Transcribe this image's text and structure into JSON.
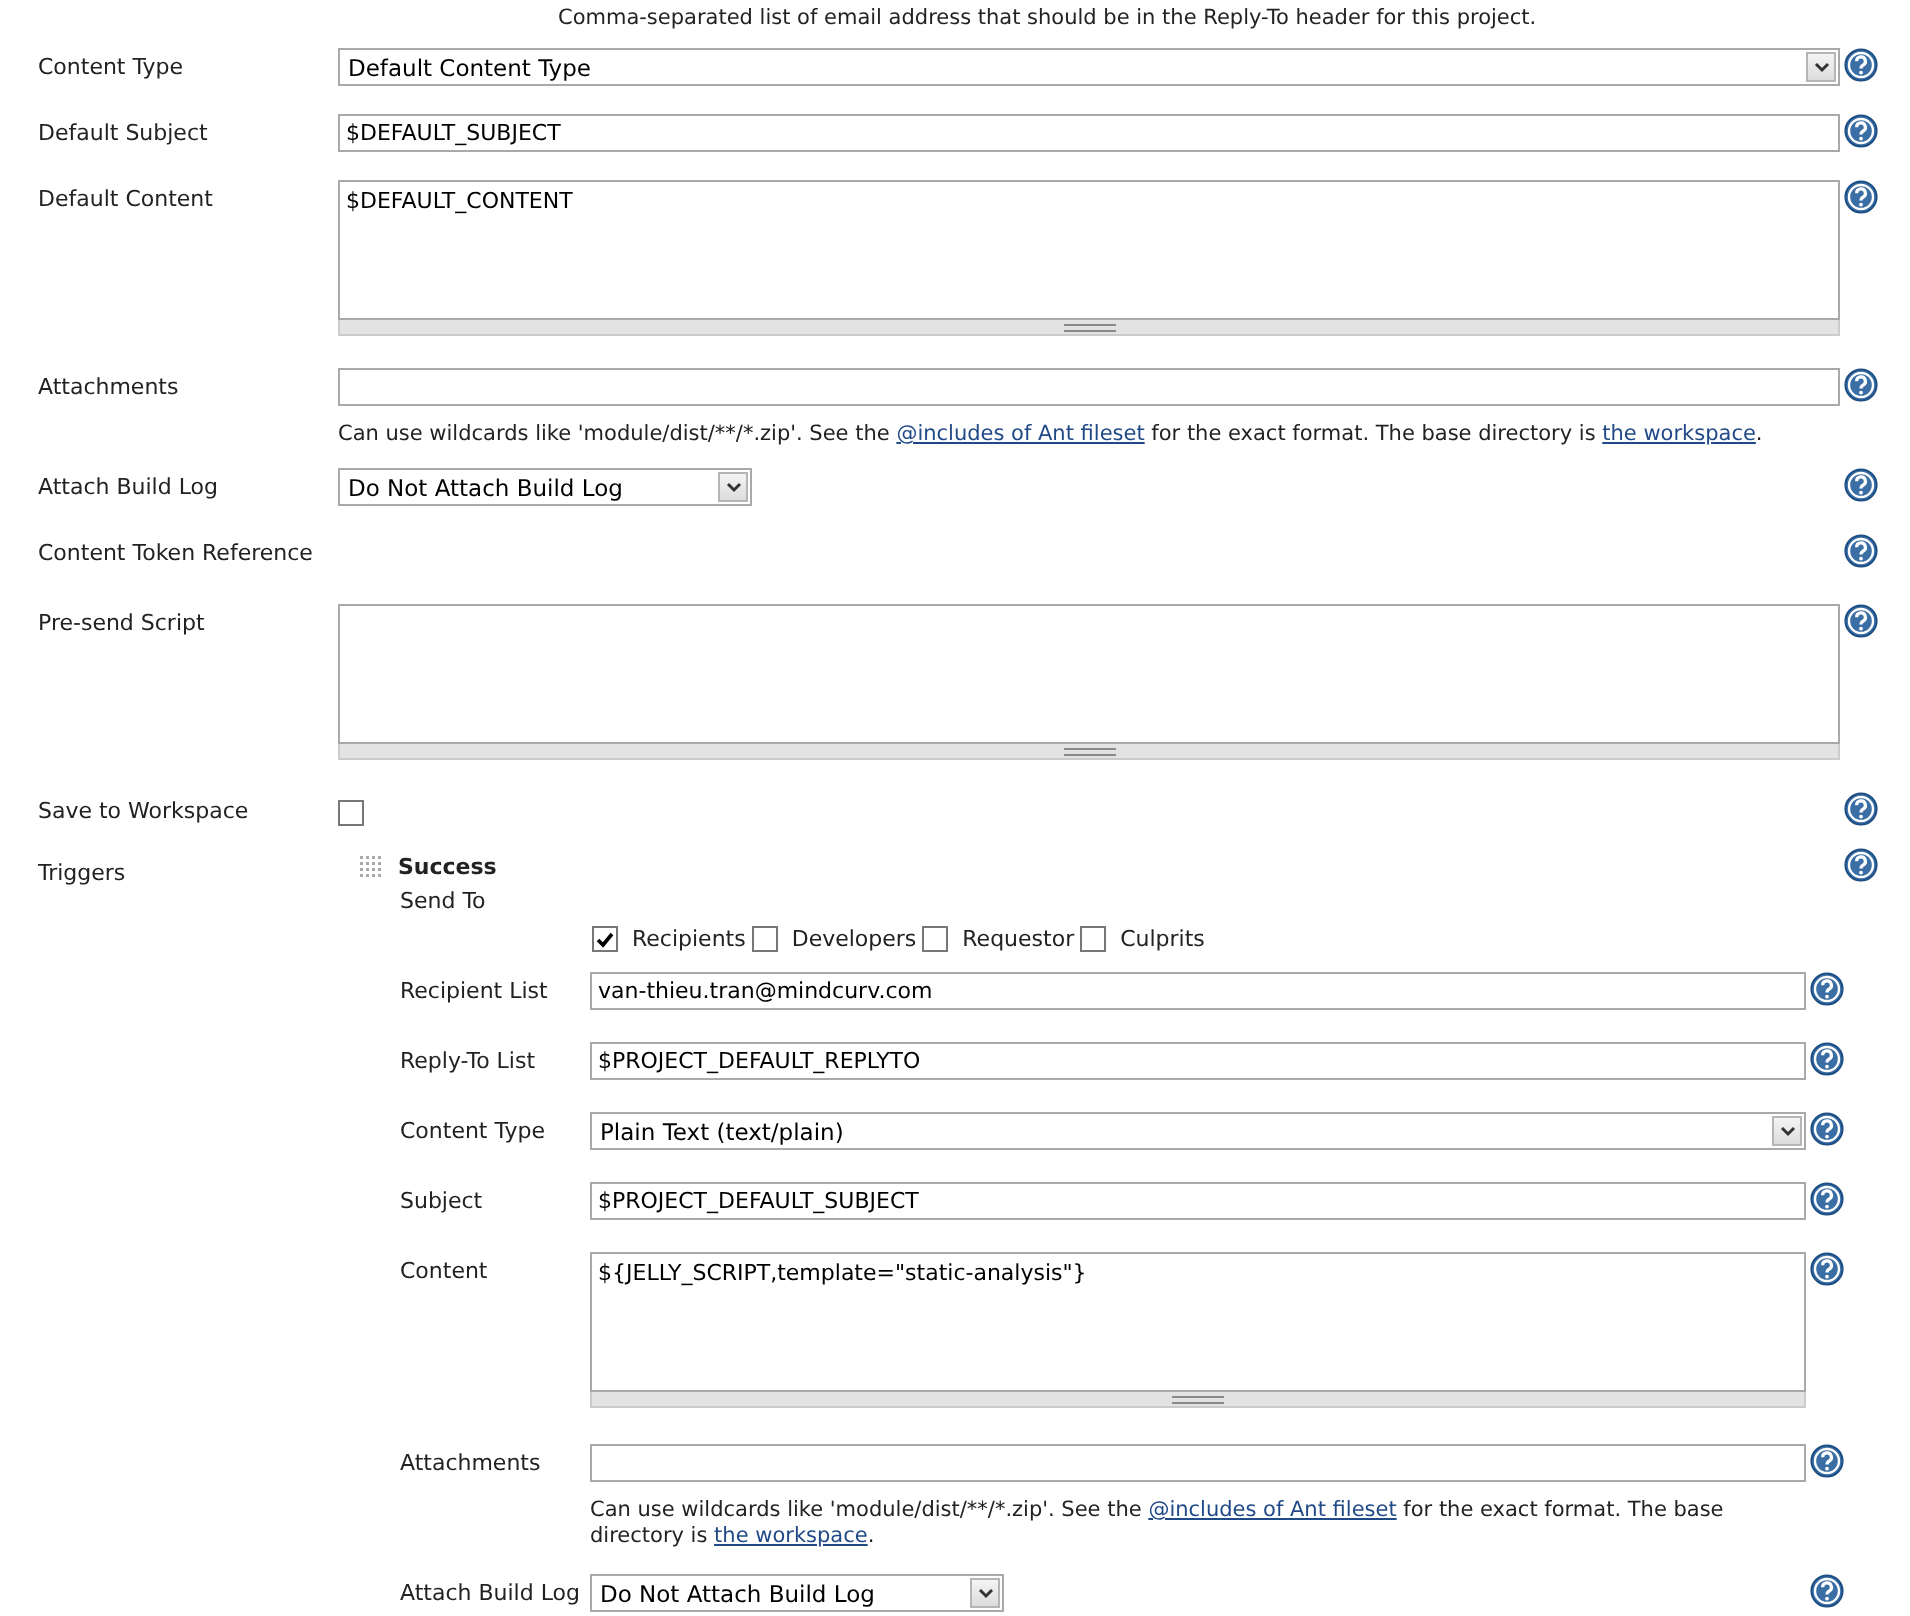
{
  "header_note": "Comma-separated list of email address that should be in the Reply-To header for this project.",
  "settings": [
    {
      "kind": "dropdown",
      "label": "Content Type",
      "value": "Default Content Type"
    },
    {
      "kind": "text",
      "label": "Default Subject",
      "value": "$DEFAULT_SUBJECT"
    },
    {
      "kind": "textarea",
      "label": "Default Content",
      "value": "$DEFAULT_CONTENT"
    },
    {
      "kind": "text",
      "label": "Attachments",
      "hint": [
        {
          "kind": "text",
          "text": "Can use wildcards like 'module/dist/**/*.zip'. See the "
        },
        {
          "kind": "link",
          "text": "@includes of Ant fileset"
        },
        {
          "kind": "text",
          "text": " for the exact format. The base directory is "
        },
        {
          "kind": "link",
          "text": "the workspace"
        },
        {
          "kind": "text",
          "text": "."
        }
      ]
    },
    {
      "kind": "compact-dropdown",
      "label": "Attach Build Log",
      "value": "Do Not Attach Build Log"
    },
    {
      "kind": "plain",
      "label": "Content Token Reference"
    },
    {
      "kind": "textarea",
      "label": "Pre-send Script"
    },
    {
      "kind": "checkbox",
      "label": "Save to Workspace",
      "checked": false
    },
    {
      "kind": "triggers",
      "label": "Triggers",
      "trigger": {
        "name": "Success",
        "send_to": {
          "label": "Send To",
          "options": [
            {
              "label": "Recipients",
              "checked": true
            },
            {
              "label": "Developers",
              "checked": false
            },
            {
              "label": "Requestor",
              "checked": false
            },
            {
              "label": "Culprits",
              "checked": false
            }
          ]
        },
        "fields": [
          {
            "kind": "text",
            "label": "Recipient List",
            "value": "van-thieu.tran@mindcurv.com"
          },
          {
            "kind": "text",
            "label": "Reply-To List",
            "value": "$PROJECT_DEFAULT_REPLYTO"
          },
          {
            "kind": "dropdown",
            "label": "Content Type",
            "value": "Plain Text (text/plain)"
          },
          {
            "kind": "text",
            "label": "Subject",
            "value": "$PROJECT_DEFAULT_SUBJECT"
          },
          {
            "kind": "textarea",
            "label": "Content",
            "value": "${JELLY_SCRIPT,template=\"static-analysis\"}"
          },
          {
            "kind": "text",
            "label": "Attachments",
            "hint": [
              {
                "kind": "text",
                "text": "Can use wildcards like 'module/dist/**/*.zip'. See the "
              },
              {
                "kind": "link",
                "text": "@includes of Ant fileset"
              },
              {
                "kind": "text",
                "text": " for the exact format. The base directory is "
              },
              {
                "kind": "link",
                "text": "the workspace"
              },
              {
                "kind": "text",
                "text": "."
              }
            ]
          },
          {
            "kind": "compact-dropdown",
            "label": "Attach Build Log",
            "value": "Do Not Attach Build Log"
          }
        ]
      }
    }
  ]
}
